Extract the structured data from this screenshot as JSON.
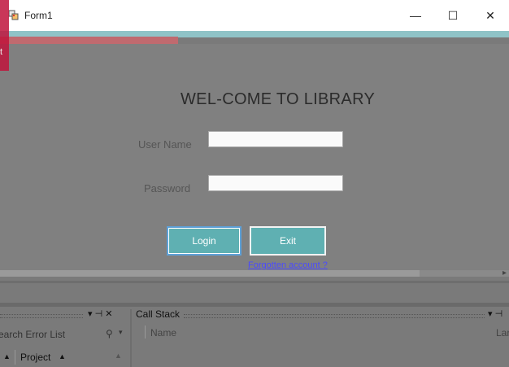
{
  "window": {
    "title": "Form1",
    "minimize_glyph": "—",
    "maximize_glyph": "☐",
    "close_glyph": "✕"
  },
  "form": {
    "heading": "WEL-COME TO LIBRARY",
    "username_label": "User Name",
    "username_value": "",
    "password_label": "Password",
    "password_value": "",
    "login_label": "Login",
    "exit_label": "Exit",
    "forgot_link": "Forgotten account ?"
  },
  "side_tab": {
    "label": "t"
  },
  "bottom_panes": {
    "left_pane": {
      "search_placeholder": "earch Error List",
      "search_icon_glyph": "⚲",
      "dropdown_glyph": "▾",
      "pin_glyph": "▾ ⊣ ✕",
      "project_column": "Project",
      "sort_up_glyph": "▲",
      "scroll_up_glyph": "▲"
    },
    "right_pane": {
      "title": "Call Stack",
      "name_column": "Name",
      "language_column": "Lar",
      "controls_glyph": "▾ ⊣"
    }
  },
  "scroll_arrow_glyph": "▸",
  "colors": {
    "accent_teal": "#5fb0b2",
    "strip_teal": "#8fc3c7",
    "strip_red": "#c06a6f",
    "tab_red": "#c0143c",
    "link_blue": "#4a4aff"
  }
}
